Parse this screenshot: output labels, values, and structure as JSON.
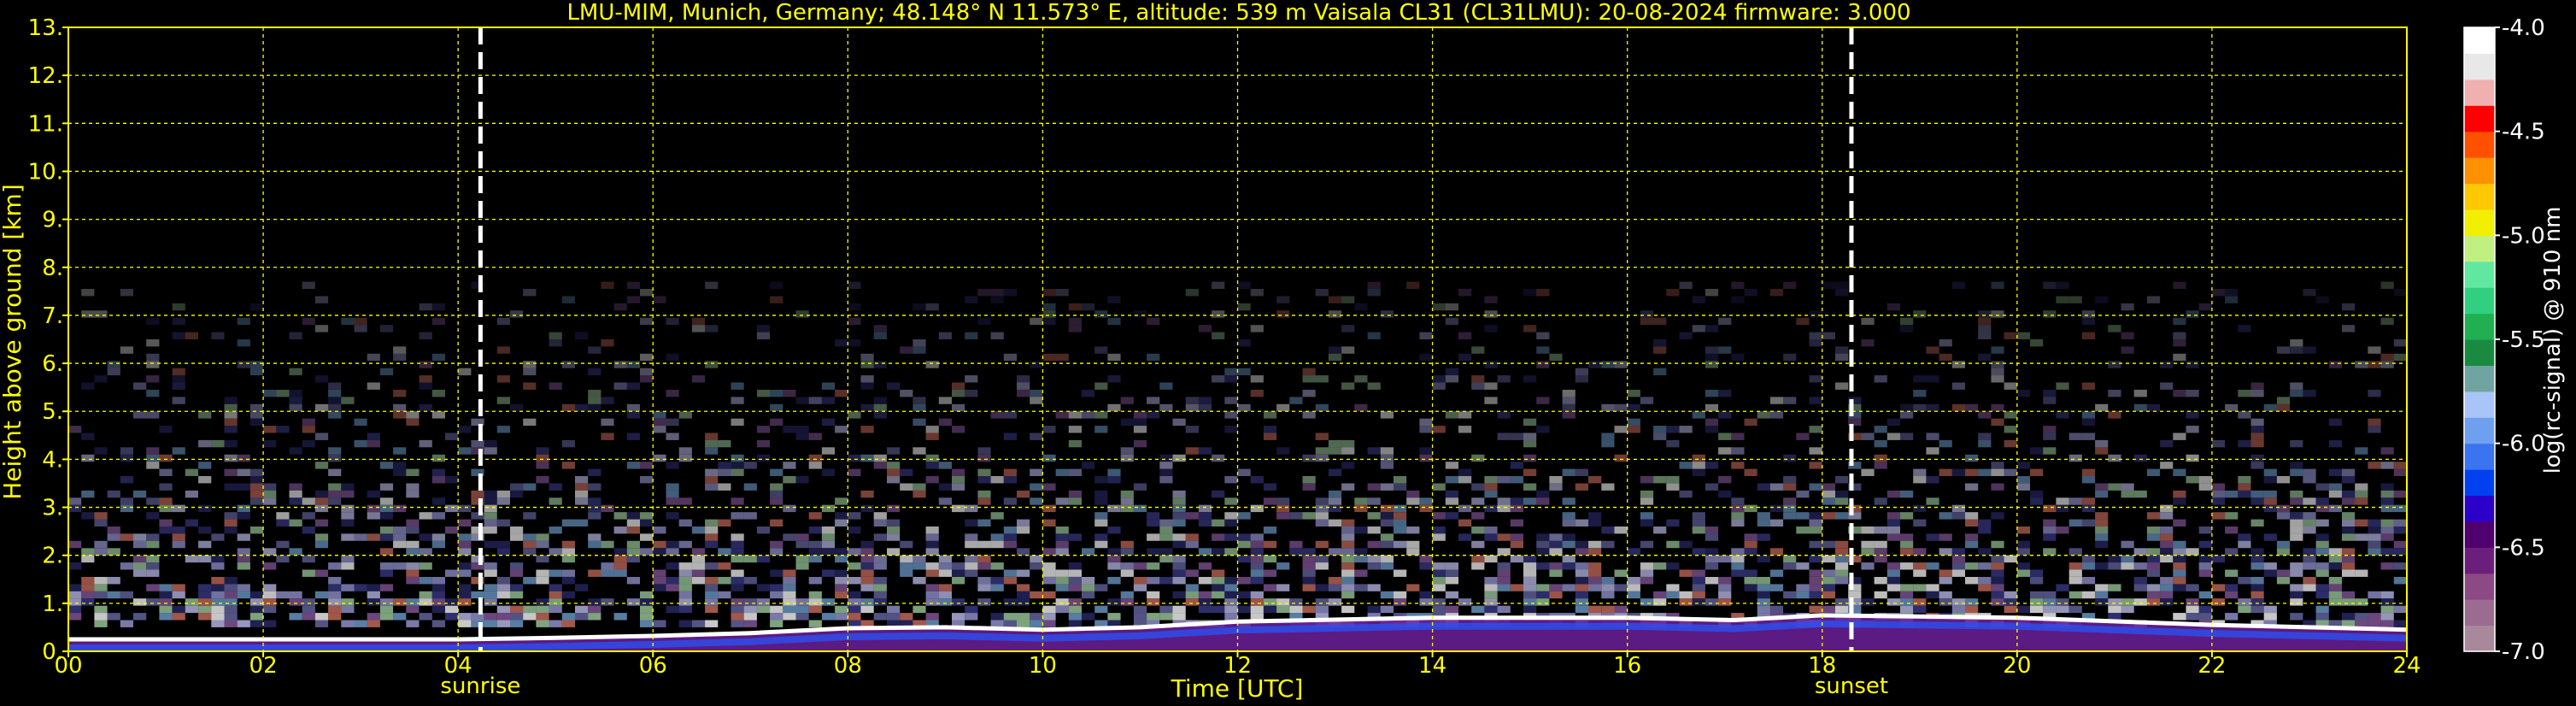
{
  "title": "LMU-MIM, Munich, Germany; 48.148° N 11.573° E, altitude: 539 m    Vaisala CL31 (CL31LMU): 20-08-2024    firmware: 3.000",
  "chart_data": {
    "type": "heatmap",
    "xlabel": "Time [UTC]",
    "ylabel": "Height above ground [km]",
    "xlim": [
      0,
      24
    ],
    "ylim": [
      0,
      13
    ],
    "x_ticks": [
      "00",
      "02",
      "04",
      "06",
      "08",
      "10",
      "12",
      "14",
      "16",
      "18",
      "20",
      "22",
      "24"
    ],
    "y_ticks": [
      "0.",
      "1.",
      "2.",
      "3.",
      "4.",
      "5.",
      "6.",
      "7.",
      "8.",
      "9.",
      "10.",
      "11.",
      "12.",
      "13."
    ],
    "grid": true,
    "markers": [
      {
        "label": "sunrise",
        "x": 4.23
      },
      {
        "label": "sunset",
        "x": 18.3
      }
    ],
    "noise_top_km": 7.7,
    "boundary_layer_top_km": [
      [
        0,
        0.25
      ],
      [
        2,
        0.25
      ],
      [
        4,
        0.25
      ],
      [
        5,
        0.28
      ],
      [
        6,
        0.32
      ],
      [
        7,
        0.38
      ],
      [
        8,
        0.48
      ],
      [
        9,
        0.5
      ],
      [
        10,
        0.45
      ],
      [
        11,
        0.5
      ],
      [
        12,
        0.62
      ],
      [
        14,
        0.7
      ],
      [
        16,
        0.7
      ],
      [
        17.1,
        0.65
      ],
      [
        18,
        0.75
      ],
      [
        20,
        0.7
      ],
      [
        22,
        0.55
      ],
      [
        24,
        0.45
      ]
    ],
    "colorbar": {
      "label": "log(rc-signal) @ 910 nm",
      "range": [
        -7.0,
        -4.0
      ],
      "ticks": [
        "-4.0",
        "-4.5",
        "-5.0",
        "-5.5",
        "-6.0",
        "-6.5",
        "-7.0"
      ],
      "colors": [
        "#a8899c",
        "#9c6c90",
        "#8c4a84",
        "#6c1f7a",
        "#50006e",
        "#2c00c8",
        "#0040f0",
        "#3a74f0",
        "#6ea0f0",
        "#a8c4f8",
        "#70a4a0",
        "#1a8a40",
        "#20b050",
        "#30d080",
        "#60e8a0",
        "#c0f080",
        "#f0f000",
        "#ffc800",
        "#ff9000",
        "#ff5000",
        "#ff0000",
        "#f0b0b0",
        "#e8e8e8",
        "#ffffff"
      ]
    }
  }
}
